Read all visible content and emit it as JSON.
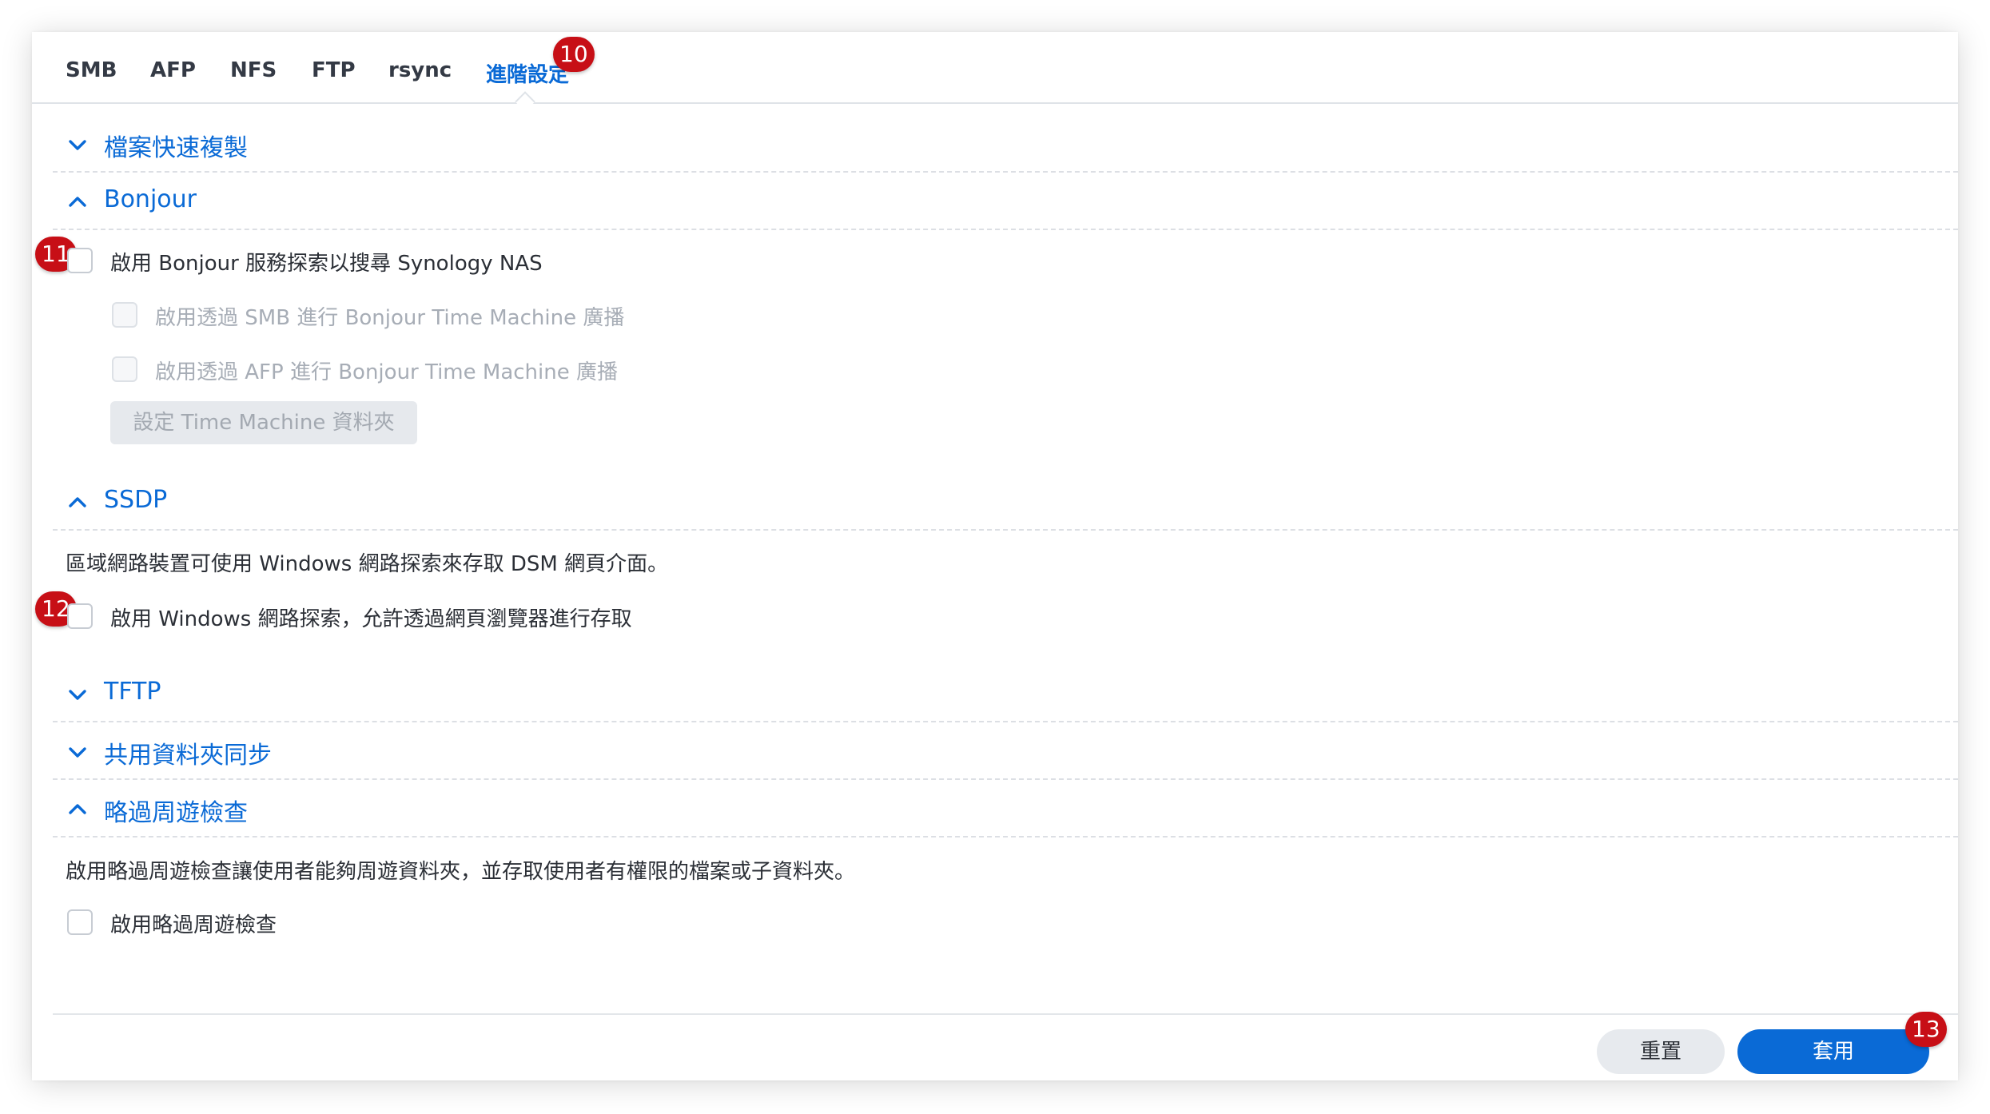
{
  "tabs": [
    {
      "label": "SMB"
    },
    {
      "label": "AFP"
    },
    {
      "label": "NFS"
    },
    {
      "label": "FTP"
    },
    {
      "label": "rsync"
    },
    {
      "label": "進階設定"
    }
  ],
  "active_tab": "進階設定",
  "badges": {
    "b10": "10",
    "b11": "11",
    "b12": "12",
    "b13": "13"
  },
  "sections": {
    "file_fast_copy": {
      "title": "檔案快速複製",
      "expanded": false
    },
    "bonjour": {
      "title": "Bonjour",
      "expanded": true,
      "enable_label": "啟用 Bonjour 服務探索以搜尋 Synology NAS",
      "smb_tm_label": "啟用透過 SMB 進行 Bonjour Time Machine 廣播",
      "afp_tm_label": "啟用透過 AFP 進行 Bonjour Time Machine 廣播",
      "tm_folder_button": "設定 Time Machine 資料夾"
    },
    "ssdp": {
      "title": "SSDP",
      "expanded": true,
      "description": "區域網路裝置可使用 Windows 網路探索來存取 DSM 網頁介面。",
      "enable_label": "啟用 Windows 網路探索，允許透過網頁瀏覽器進行存取"
    },
    "tftp": {
      "title": "TFTP",
      "expanded": false
    },
    "shared_folder_sync": {
      "title": "共用資料夾同步",
      "expanded": false
    },
    "bypass_traverse": {
      "title": "略過周遊檢查",
      "expanded": true,
      "description": "啟用略過周遊檢查讓使用者能夠周遊資料夾，並存取使用者有權限的檔案或子資料夾。",
      "enable_label": "啟用略過周遊檢查"
    }
  },
  "footer": {
    "reset_label": "重置",
    "apply_label": "套用"
  },
  "colors": {
    "accent": "#0a6ad6",
    "badge": "#c70f16",
    "text": "#2b2f36",
    "disabled_text": "#a7adb6"
  }
}
